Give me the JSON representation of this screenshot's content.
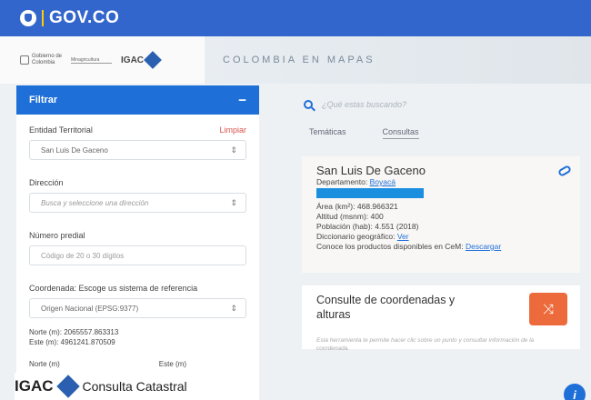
{
  "topbar": {
    "brand": "GOV.CO"
  },
  "header": {
    "gob_line1": "Gobierno de",
    "gob_line2": "Colombia",
    "min_text": "Minagricultura",
    "igac_label": "IGAC",
    "map_title": "COLOMBIA EN MAPAS"
  },
  "filter": {
    "title": "Filtrar",
    "collapse": "−",
    "entity_label": "Entidad Territorial",
    "clear_label": "Limpiar",
    "entity_value": "San Luis De Gaceno",
    "address_label": "Dirección",
    "address_placeholder": "Busca y seleccione una dirección",
    "predial_label": "Número predial",
    "predial_placeholder": "Código de 20 o 30 dígitos",
    "coord_label": "Coordenada: Escoge us sistema de referencia",
    "coord_value": "Origen Nacional (EPSG:9377)",
    "north_readout": "Norte (m): 2065557.863313",
    "east_readout": "Este (m): 4961241.870509",
    "north_label": "Norte (m)",
    "east_label": "Este (m)"
  },
  "footer": {
    "igac": "IGAC",
    "title": "Consulta Catastral"
  },
  "right": {
    "search_placeholder": "¿Qué estas buscando?",
    "tab1": "Temáticas",
    "tab2": "Consultas",
    "info": {
      "title": "San Luis De Gaceno",
      "dept_label": "Departamento: ",
      "dept_value": "Boyacá",
      "area": "Área (km²): 468.966321",
      "altitud": "Altitud (msnm): 400",
      "poblacion": "Población (hab): 4.551 (2018)",
      "dic_label": "Diccionario geográfico: ",
      "dic_link": "Ver",
      "productos_label": "Conoce los productos disponibles en CeM: ",
      "productos_link": "Descargar"
    },
    "consult": {
      "title_line1": "Consulte de coordenadas y",
      "title_line2": "alturas",
      "icon": "shuffle-icon",
      "desc": "Esta herramienta te permite hacer clic sobre un punto y consultar información de la coordenada."
    }
  },
  "info_button": "i",
  "colors": {
    "gov_blue": "#3366cc",
    "filter_blue": "#1f6fd9",
    "orange": "#ec6a3c",
    "clear_red": "#d9534f"
  }
}
